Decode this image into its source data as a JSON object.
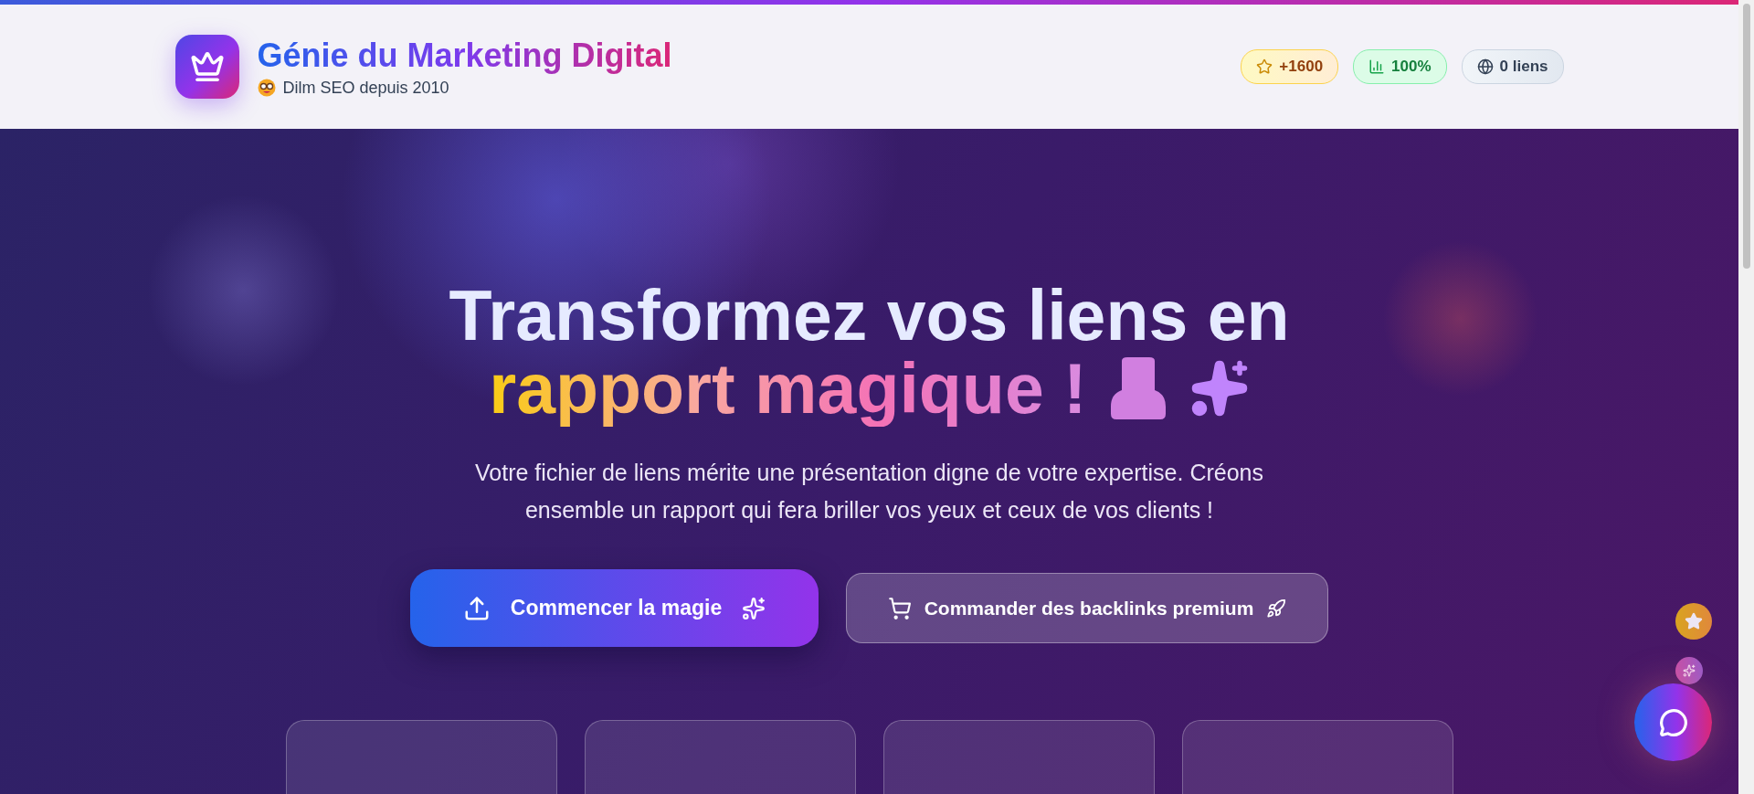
{
  "brand": {
    "title": "Génie du Marketing Digital",
    "subtitle": "Dilm SEO depuis 2010"
  },
  "badges": [
    {
      "kind": "stars",
      "label": "+1600"
    },
    {
      "kind": "chart",
      "label": "100%"
    },
    {
      "kind": "globe",
      "label": "0 liens"
    }
  ],
  "hero": {
    "headline": "Transformez vos liens en",
    "highlight": "rapport magique !",
    "description": "Votre fichier de liens mérite une présentation digne de votre expertise. Créons ensemble un rapport qui fera briller vos yeux et ceux de vos clients !",
    "primary_button": "Commencer la magie",
    "secondary_button": "Commander des backlinks premium"
  },
  "feature_cards": [
    {
      "kind": "card"
    },
    {
      "kind": "card"
    },
    {
      "kind": "card"
    },
    {
      "kind": "card"
    }
  ],
  "floating_actions": [
    {
      "kind": "star"
    },
    {
      "kind": "sparkle"
    },
    {
      "kind": "chat"
    }
  ]
}
